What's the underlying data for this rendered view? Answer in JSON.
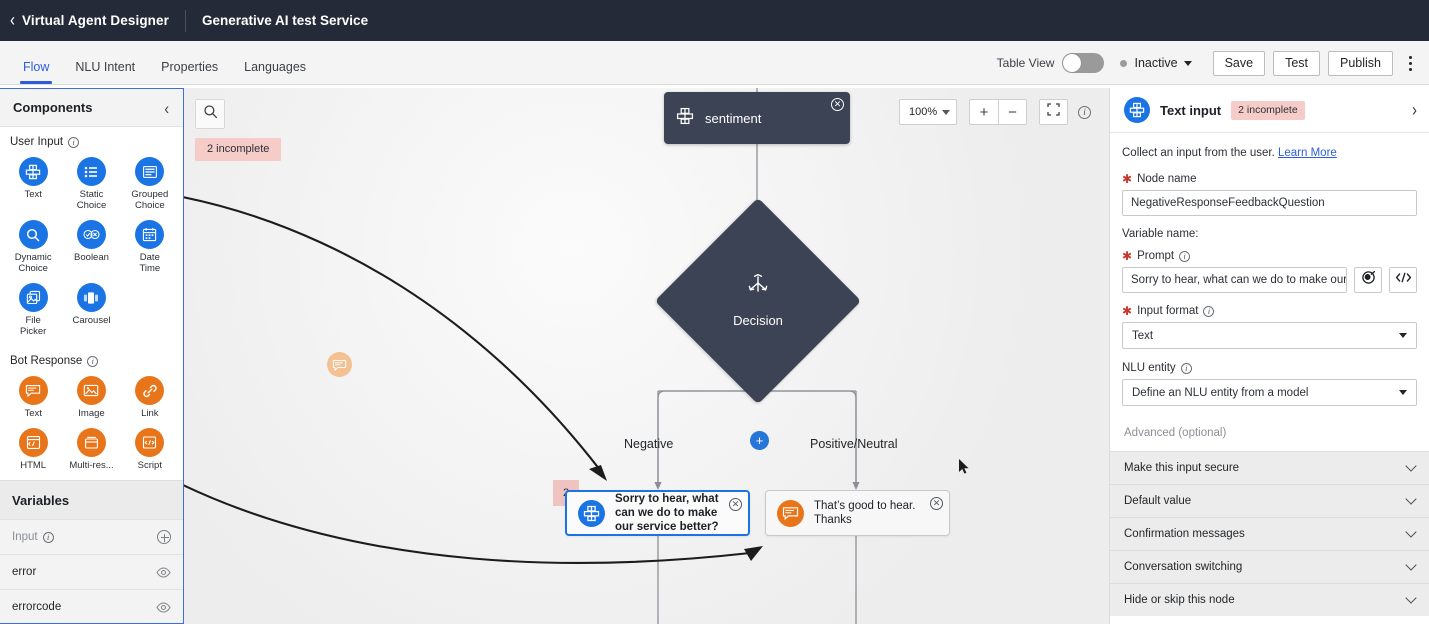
{
  "topbar": {
    "back_icon": "chevron-left-icon",
    "app_name": "Virtual Agent Designer",
    "service_title": "Generative AI test Service"
  },
  "tabs": [
    {
      "label": "Flow",
      "active": true
    },
    {
      "label": "NLU Intent",
      "active": false
    },
    {
      "label": "Properties",
      "active": false
    },
    {
      "label": "Languages",
      "active": false
    }
  ],
  "toolbar": {
    "table_view_label": "Table View",
    "table_view_on": false,
    "status_label": "Inactive",
    "status_color": "#9b9b9b",
    "save_label": "Save",
    "test_label": "Test",
    "publish_label": "Publish",
    "kebab_icon": "more-vertical-icon"
  },
  "left_panel": {
    "title": "Components",
    "collapse_icon": "chevron-left-icon",
    "sections": [
      {
        "name": "User Input",
        "items": [
          {
            "label": "Text",
            "icon": "text-input-icon",
            "color": "blue"
          },
          {
            "label": "Static\nChoice",
            "icon": "static-choice-icon",
            "color": "blue"
          },
          {
            "label": "Grouped\nChoice",
            "icon": "grouped-choice-icon",
            "color": "blue"
          },
          {
            "label": "Dynamic\nChoice",
            "icon": "dynamic-choice-icon",
            "color": "blue"
          },
          {
            "label": "Boolean",
            "icon": "boolean-icon",
            "color": "blue"
          },
          {
            "label": "Date\nTime",
            "icon": "date-time-icon",
            "color": "blue"
          },
          {
            "label": "File\nPicker",
            "icon": "file-picker-icon",
            "color": "blue"
          },
          {
            "label": "Carousel",
            "icon": "carousel-icon",
            "color": "blue"
          }
        ]
      },
      {
        "name": "Bot Response",
        "items": [
          {
            "label": "Text",
            "icon": "text-response-icon",
            "color": "orange"
          },
          {
            "label": "Image",
            "icon": "image-icon",
            "color": "orange"
          },
          {
            "label": "Link",
            "icon": "link-icon",
            "color": "orange"
          },
          {
            "label": "HTML",
            "icon": "html-icon",
            "color": "orange"
          },
          {
            "label": "Multi-res...",
            "icon": "multi-response-icon",
            "color": "orange"
          },
          {
            "label": "Script",
            "icon": "script-icon",
            "color": "orange"
          }
        ]
      }
    ],
    "variables": {
      "title": "Variables",
      "group_label": "Input",
      "add_icon": "plus-circle-icon",
      "rows": [
        {
          "name": "error",
          "icon": "eye-icon"
        },
        {
          "name": "errorcode",
          "icon": "eye-icon"
        }
      ]
    }
  },
  "canvas": {
    "search_icon": "search-icon",
    "incomplete_banner": "2 incomplete",
    "zoom_level": "100%",
    "zoom_in_label": "+",
    "zoom_out_label": "−",
    "fit_icon": "fit-screen-icon",
    "info_icon": "info-icon",
    "nodes": {
      "sentiment": {
        "label": "sentiment",
        "icon": "text-input-icon",
        "close_icon": "close-circle-icon"
      },
      "decision": {
        "label": "Decision",
        "icon": "branch-icon"
      },
      "add_node_label": "+",
      "branch_left_label": "Negative",
      "branch_right_label": "Positive/Neutral",
      "negative_node": {
        "text": "Sorry to hear, what can we do to make our service better?",
        "icon": "text-input-icon",
        "badge": "2",
        "close_icon": "close-circle-icon",
        "selected": true
      },
      "positive_node": {
        "text": "That’s good to hear. Thanks",
        "icon": "text-response-icon",
        "close_icon": "close-circle-icon",
        "selected": false
      }
    },
    "drag_ghost_icon": "text-response-icon"
  },
  "right_panel": {
    "icon": "text-input-icon",
    "title": "Text input",
    "badge": "2 incomplete",
    "expand_icon": "chevron-right-icon",
    "description": "Collect an input from the user.",
    "learn_more": "Learn More",
    "node_name_label": "Node name",
    "node_name_value": "NegativeResponseFeedbackQuestion",
    "variable_name_label": "Variable name:",
    "prompt_label": "Prompt",
    "prompt_value": "Sorry to hear, what can we do to make our servi...",
    "prompt_ai_icon": "ai-assist-icon",
    "prompt_code_icon": "code-icon",
    "input_format_label": "Input format",
    "input_format_value": "Text",
    "nlu_entity_label": "NLU entity",
    "nlu_entity_value": "Define an NLU entity from a model",
    "advanced_label": "Advanced (optional)",
    "accordions": [
      "Make this input secure",
      "Default value",
      "Confirmation messages",
      "Conversation switching",
      "Hide or skip this node"
    ]
  },
  "colors": {
    "brand_blue": "#1b74e4",
    "accent_blue": "#2e5ddc",
    "orange": "#e8751a",
    "dark_node": "#3c4354",
    "warning_pink": "#f6ccc9"
  }
}
